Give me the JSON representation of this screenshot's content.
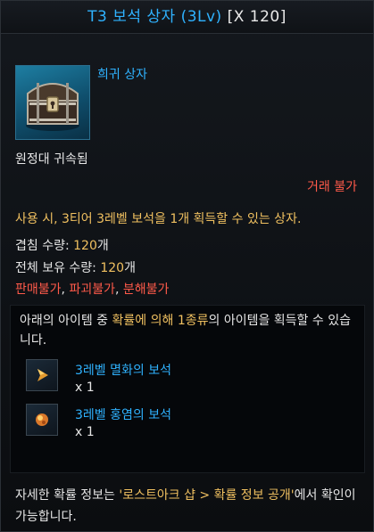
{
  "header": {
    "title": "T3 보석 상자 (3Lv)",
    "count": "[X 120]",
    "grade": "희귀 상자"
  },
  "item_icon": "treasure-chest-icon",
  "bound": "원정대 귀속됨",
  "trade": "거래 불가",
  "description": "사용 시, 3티어 3레벨 보석을 1개 획득할 수 있는 상자.",
  "stack": {
    "label": "겹침 수량: ",
    "value": "120",
    "unit": "개"
  },
  "owned": {
    "label": "전체 보유 수량: ",
    "value": "120",
    "unit": "개"
  },
  "restrictions": {
    "a": "판매불가",
    "sep": ", ",
    "b": "파괴불가",
    "c": "분해불가"
  },
  "reward_box": {
    "intro_a": "아래의 아이템 중 ",
    "intro_b": "확률에 의해 1종류",
    "intro_c": "의 아이템을 획득할 수 있습니다.",
    "items": [
      {
        "name": "3레벨 멸화의 보석",
        "qty": "x 1",
        "icon": "annihilation-gem-icon"
      },
      {
        "name": "3레벨 홍염의 보석",
        "qty": "x 1",
        "icon": "crimson-flame-gem-icon"
      }
    ]
  },
  "footer": {
    "a": "자세한 확률 정보는 ",
    "b": "'로스트아크 샵 > 확률 정보 공개'",
    "c": "에서 확인이 가능합니다."
  },
  "colors": {
    "title_blue": "#2fb2ff",
    "highlight_yellow": "#f0c060",
    "warning_red": "#ff5a4a"
  }
}
